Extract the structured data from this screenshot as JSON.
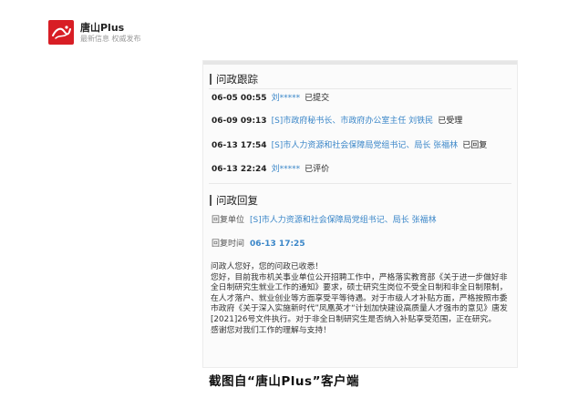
{
  "app": {
    "title": "唐山Plus",
    "subtitle": "最新信息 权威发布",
    "brand_color": "#d81e25"
  },
  "tracking": {
    "heading": "问政跟踪",
    "rows": [
      {
        "time": "06-05 00:55",
        "actor": "刘*****",
        "status": "已提交"
      },
      {
        "time": "06-09 09:13",
        "actor": "[S]市政府秘书长、市政府办公室主任 刘铁民",
        "status": "已受理"
      },
      {
        "time": "06-13 17:54",
        "actor": "[S]市人力资源和社会保障局党组书记、局长 张福林",
        "status": "已回复"
      },
      {
        "time": "06-13 22:24",
        "actor": "刘*****",
        "status": "已评价"
      }
    ]
  },
  "reply": {
    "heading": "问政回复",
    "unit_label": "回复单位",
    "unit_value": "[S]市人力资源和社会保障局党组书记、局长 张福林",
    "time_label": "回复时间",
    "time_value": "06-13 17:25",
    "body": [
      "问政人您好，您的问政已收悉！",
      "您好，目前我市机关事业单位公开招聘工作中，严格落实教育部《关于进一步做好非全日制研究生就业工作的通知》要求，硕士研究生岗位不受全日制和非全日制限制，在人才落户、就业创业等方面享受平等待遇。对于市级人才补贴方面，严格按照市委市政府《关于深入实施新时代”凤凰英才“计划加快建设高质量人才强市的意见》唐发[2021]26号文件执行。对于非全日制研究生是否纳入补贴享受范围，正在研究。",
      "感谢您对我们工作的理解与支持！"
    ]
  },
  "caption": "截图自“唐山Plus”客户端",
  "link_color": "#3a86c8"
}
